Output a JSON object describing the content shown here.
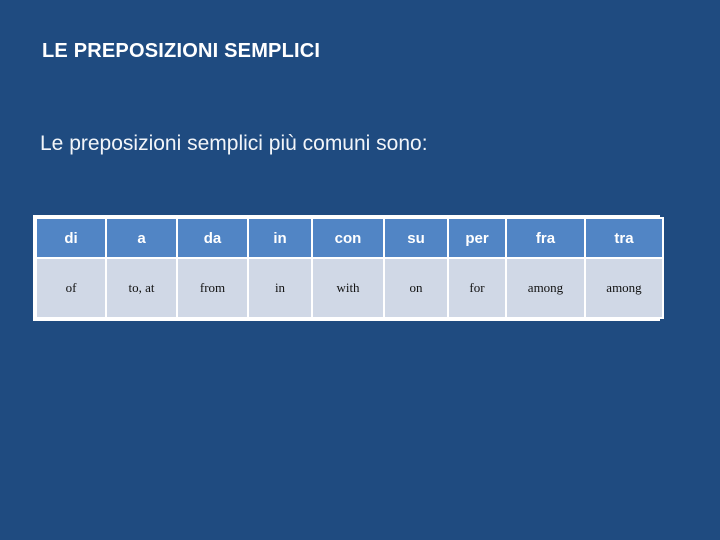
{
  "slide": {
    "title": "LE PREPOSIZIONI SEMPLICI",
    "subtitle": "Le preposizioni semplici più comuni sono:",
    "background_color": "#1F4B80",
    "title_color": "#FFFFFF",
    "subtitle_color": "#F2F5F9"
  },
  "table": {
    "header_bg_color": "#5185C5",
    "header_text_color": "#FFFFFF",
    "body_bg_color": "#D0D8E6",
    "body_text_color": "#111111",
    "gridline_color": "#FFFFFF",
    "headers": [
      "di",
      "a",
      "da",
      "in",
      "con",
      "su",
      "per",
      "fra",
      "tra"
    ],
    "rows": [
      [
        "of",
        "to, at",
        "from",
        "in",
        "with",
        "on",
        "for",
        "among",
        "among"
      ]
    ]
  }
}
